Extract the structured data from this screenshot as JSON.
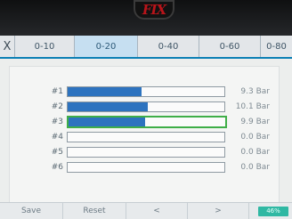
{
  "brand": "FIX",
  "tabs": [
    {
      "label": "X"
    },
    {
      "label": "0-10"
    },
    {
      "label": "0-20",
      "active": true
    },
    {
      "label": "0-40"
    },
    {
      "label": "0-60"
    },
    {
      "label": "0-80"
    }
  ],
  "channels": [
    {
      "label": "#1",
      "value": "9.3 Bar",
      "fill_pct": 47
    },
    {
      "label": "#2",
      "value": "10.1 Bar",
      "fill_pct": 51
    },
    {
      "label": "#3",
      "value": "9.9 Bar",
      "fill_pct": 49,
      "selected": true
    },
    {
      "label": "#4",
      "value": "0.0 Bar",
      "fill_pct": 0
    },
    {
      "label": "#5",
      "value": "0.0 Bar",
      "fill_pct": 0
    },
    {
      "label": "#6",
      "value": "0.0 Bar",
      "fill_pct": 0
    }
  ],
  "footer": {
    "save": "Save",
    "reset": "Reset",
    "prev": "<",
    "next": ">",
    "battery": "46%"
  },
  "colors": {
    "fill": "#2d73bf",
    "selected_border": "#3fae48",
    "tab_active": "#c6dff1",
    "battery": "#2fb8a3"
  }
}
